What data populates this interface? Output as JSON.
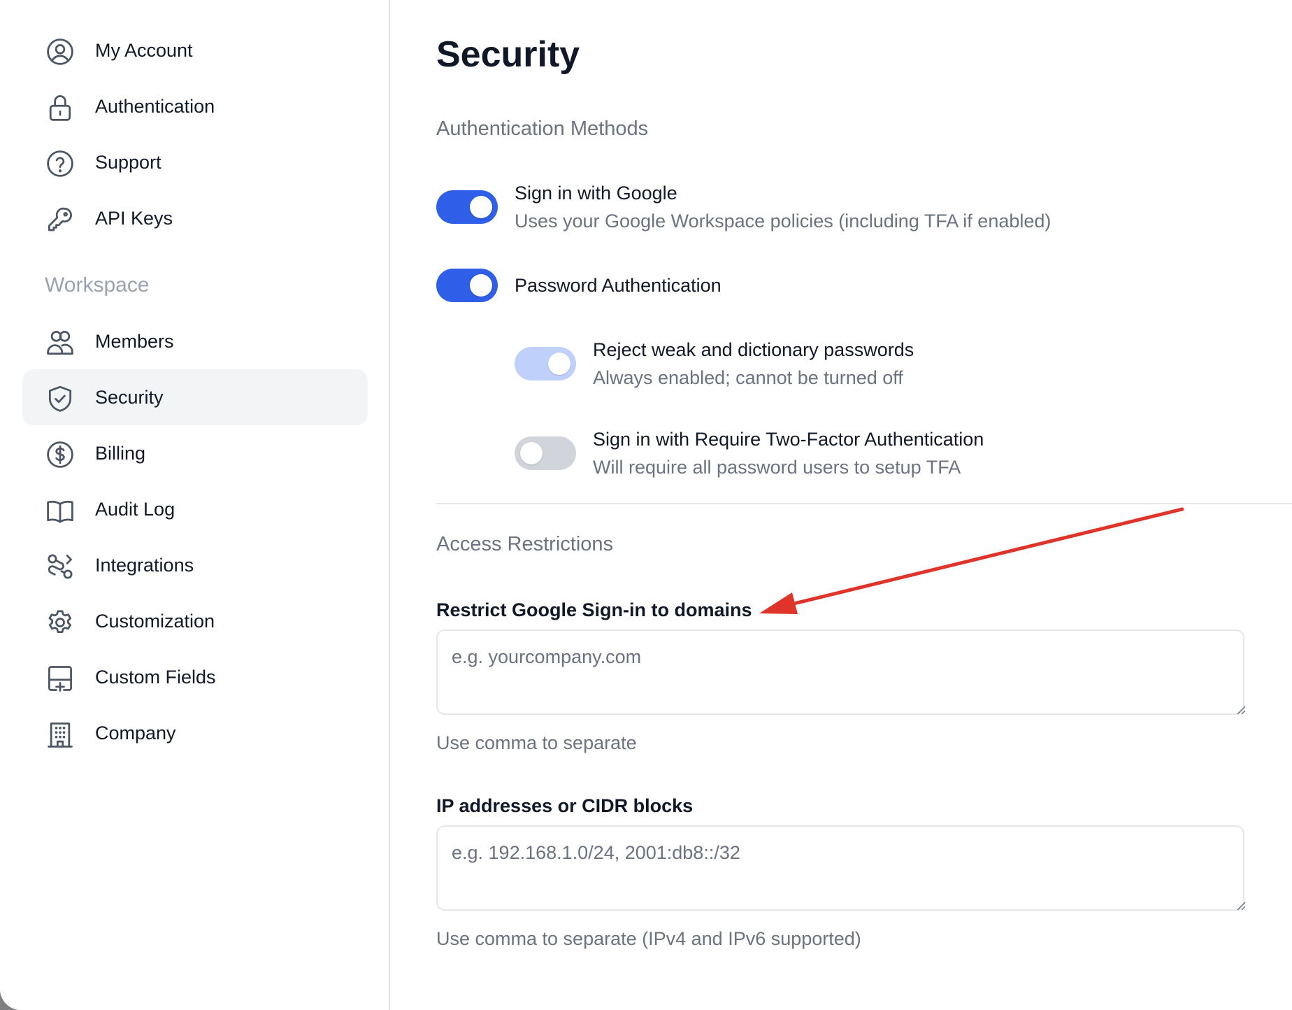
{
  "sidebar": {
    "account_items": [
      {
        "label": "My Account",
        "icon": "user-circle-icon"
      },
      {
        "label": "Authentication",
        "icon": "lock-icon"
      },
      {
        "label": "Support",
        "icon": "question-circle-icon"
      },
      {
        "label": "API Keys",
        "icon": "key-icon"
      }
    ],
    "section_label": "Workspace",
    "workspace_items": [
      {
        "label": "Members",
        "icon": "users-icon"
      },
      {
        "label": "Security",
        "icon": "shield-check-icon",
        "active": true
      },
      {
        "label": "Billing",
        "icon": "dollar-circle-icon"
      },
      {
        "label": "Audit Log",
        "icon": "book-open-icon"
      },
      {
        "label": "Integrations",
        "icon": "integrations-icon"
      },
      {
        "label": "Customization",
        "icon": "gear-icon"
      },
      {
        "label": "Custom Fields",
        "icon": "custom-fields-icon"
      },
      {
        "label": "Company",
        "icon": "building-icon"
      }
    ]
  },
  "main": {
    "title": "Security",
    "auth_methods": {
      "heading": "Authentication Methods",
      "google": {
        "title": "Sign in with Google",
        "description": "Uses your Google Workspace policies (including TFA if enabled)",
        "enabled": true
      },
      "password": {
        "title": "Password Authentication",
        "enabled": true
      },
      "weak_passwords": {
        "title": "Reject weak and dictionary passwords",
        "description": "Always enabled; cannot be turned off",
        "enabled": true,
        "disabled": true
      },
      "require_tfa": {
        "title": "Sign in with Require Two-Factor Authentication",
        "description": "Will require all password users to setup TFA",
        "enabled": false
      }
    },
    "access_restrictions": {
      "heading": "Access Restrictions",
      "domains": {
        "label": "Restrict Google Sign-in to domains",
        "placeholder": "e.g. yourcompany.com",
        "value": "",
        "hint": "Use comma to separate"
      },
      "ips": {
        "label": "IP addresses or CIDR blocks",
        "placeholder": "e.g. 192.168.1.0/24, 2001:db8::/32",
        "value": "",
        "hint": "Use comma to separate (IPv4 and IPv6 supported)"
      }
    }
  },
  "colors": {
    "accent": "#2f5ee8",
    "accent_disabled": "#bfd0fb",
    "toggle_off": "#d1d5db",
    "annotation_arrow": "#e0342a",
    "active_nav_bg": "#f3f4f6"
  }
}
